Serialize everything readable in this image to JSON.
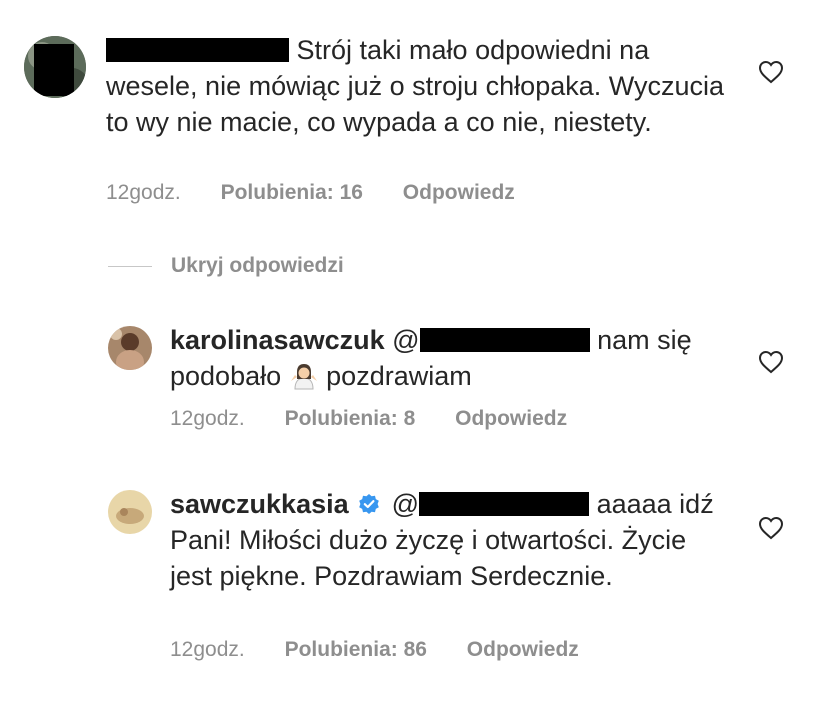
{
  "comments": [
    {
      "username": "",
      "username_redacted": true,
      "text": "Strój taki mało odpowiedni na wesele, nie mówiąc już o stroju chłopaka. Wyczucia to wy nie macie, co wypada a co nie, niestety.",
      "time": "12godz.",
      "likes": "Polubienia: 16",
      "reply": "Odpowiedz"
    },
    {
      "username": "karolinasawczuk",
      "mention": "@",
      "text_before_emoji": "nam się podobało",
      "emoji_name": "woman-shrugging-emoji",
      "text_after_emoji": "pozdrawiam",
      "time": "12godz.",
      "likes": "Polubienia: 8",
      "reply": "Odpowiedz"
    },
    {
      "username": "sawczukkasia",
      "verified": true,
      "mention": "@",
      "text": "aaaaa idź Pani! Miłości dużo życzę i otwartości. Życie jest piękne. Pozdrawiam Serdecznie.",
      "time": "12godz.",
      "likes": "Polubienia: 86",
      "reply": "Odpowiedz"
    }
  ],
  "hide_replies": "Ukryj odpowiedzi",
  "icons": {
    "like": "heart-outline-icon",
    "verified": "verified-badge-icon"
  },
  "colors": {
    "text": "#262626",
    "meta": "#8e8e8e",
    "verified": "#3897f0"
  }
}
